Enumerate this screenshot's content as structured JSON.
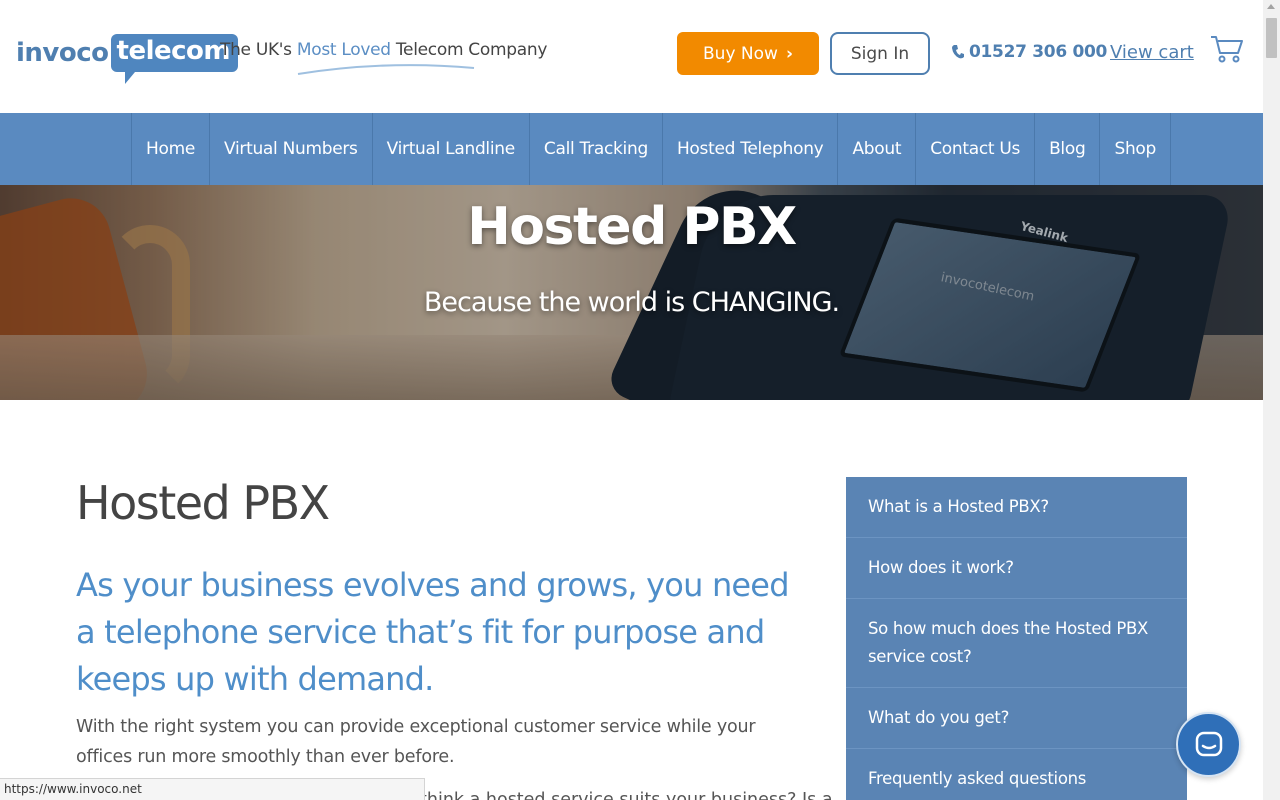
{
  "header": {
    "logo_left": "invoco",
    "logo_right": "telecom",
    "tagline_pre": "The UK's ",
    "tagline_highlight": "Most Loved",
    "tagline_post": " Telecom Company",
    "buy_now_label": "Buy Now",
    "sign_in_label": "Sign In",
    "phone": "01527 306 000",
    "view_cart_label": "View cart"
  },
  "nav": {
    "items": [
      "Home",
      "Virtual Numbers",
      "Virtual Landline",
      "Call Tracking",
      "Hosted Telephony",
      "About",
      "Contact Us",
      "Blog",
      "Shop"
    ]
  },
  "hero": {
    "title": "Hosted PBX",
    "subtitle": "Because the world is CHANGING.",
    "screen_logo": "invocotelecom",
    "phone_brand": "Yealink"
  },
  "main": {
    "title": "Hosted PBX",
    "lead": "As your business evolves and grows, you need a telephone service that’s fit for purpose and keeps up with demand.",
    "body": "With the right system you can provide exceptional customer service while your offices run more smoothly than ever before.",
    "cut_line": "think a hosted service suits your business? Is a"
  },
  "sidebar": {
    "items": [
      "What is a Hosted PBX?",
      "How does it work?",
      "So how much does the Hosted PBX service cost?",
      "What do you get?",
      "Frequently asked questions"
    ]
  },
  "status_bar": {
    "url": "https://www.invoco.net"
  },
  "colors": {
    "brand_blue": "#5a8ac0",
    "accent_orange": "#f28a00",
    "lead_blue": "#4f8ec9",
    "chat_blue": "#2f6fb8"
  }
}
